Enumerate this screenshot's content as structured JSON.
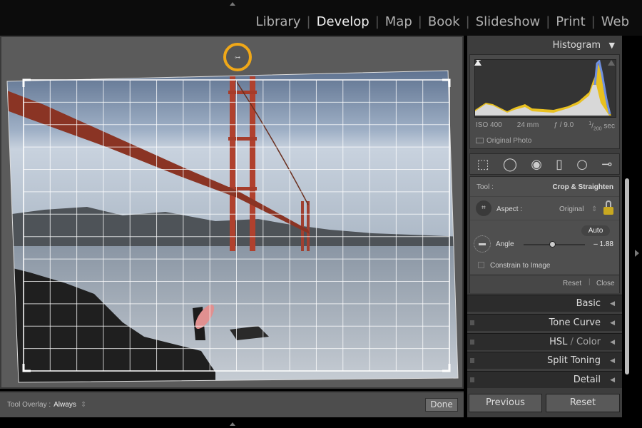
{
  "modules": [
    {
      "label": "Library",
      "active": false
    },
    {
      "label": "Develop",
      "active": true
    },
    {
      "label": "Map",
      "active": false
    },
    {
      "label": "Book",
      "active": false
    },
    {
      "label": "Slideshow",
      "active": false
    },
    {
      "label": "Print",
      "active": false
    },
    {
      "label": "Web",
      "active": false
    }
  ],
  "histogram": {
    "title": "Histogram",
    "iso": "ISO 400",
    "focal": "24 mm",
    "aperture": "ƒ / 9.0",
    "shutter_num": "1",
    "shutter_den": "200",
    "shutter_unit": "sec",
    "original_photo": "Original Photo"
  },
  "tools": [
    "crop-overlay-icon",
    "spot-removal-icon",
    "red-eye-icon",
    "graduated-filter-icon",
    "radial-filter-icon",
    "adjustment-brush-icon"
  ],
  "crop": {
    "tool_label": "Tool :",
    "tool_value": "Crop & Straighten",
    "aspect_label": "Aspect :",
    "aspect_value": "Original",
    "auto": "Auto",
    "angle_label": "Angle",
    "angle_value": "– 1.88",
    "angle": -1.88,
    "constrain": "Constrain to Image",
    "constrain_checked": false,
    "reset": "Reset",
    "close": "Close"
  },
  "panels": [
    "Basic",
    "Tone Curve",
    "HSL / Color",
    "Split Toning",
    "Detail"
  ],
  "hsl": {
    "a": "HSL",
    "sep": " / ",
    "b": "Color"
  },
  "toolbar": {
    "overlay_label": "Tool Overlay :",
    "overlay_value": "Always",
    "done": "Done"
  },
  "buttons": {
    "previous": "Previous",
    "reset": "Reset"
  },
  "colors": {
    "highlight": "#f0a818",
    "lock": "#c8a820"
  }
}
